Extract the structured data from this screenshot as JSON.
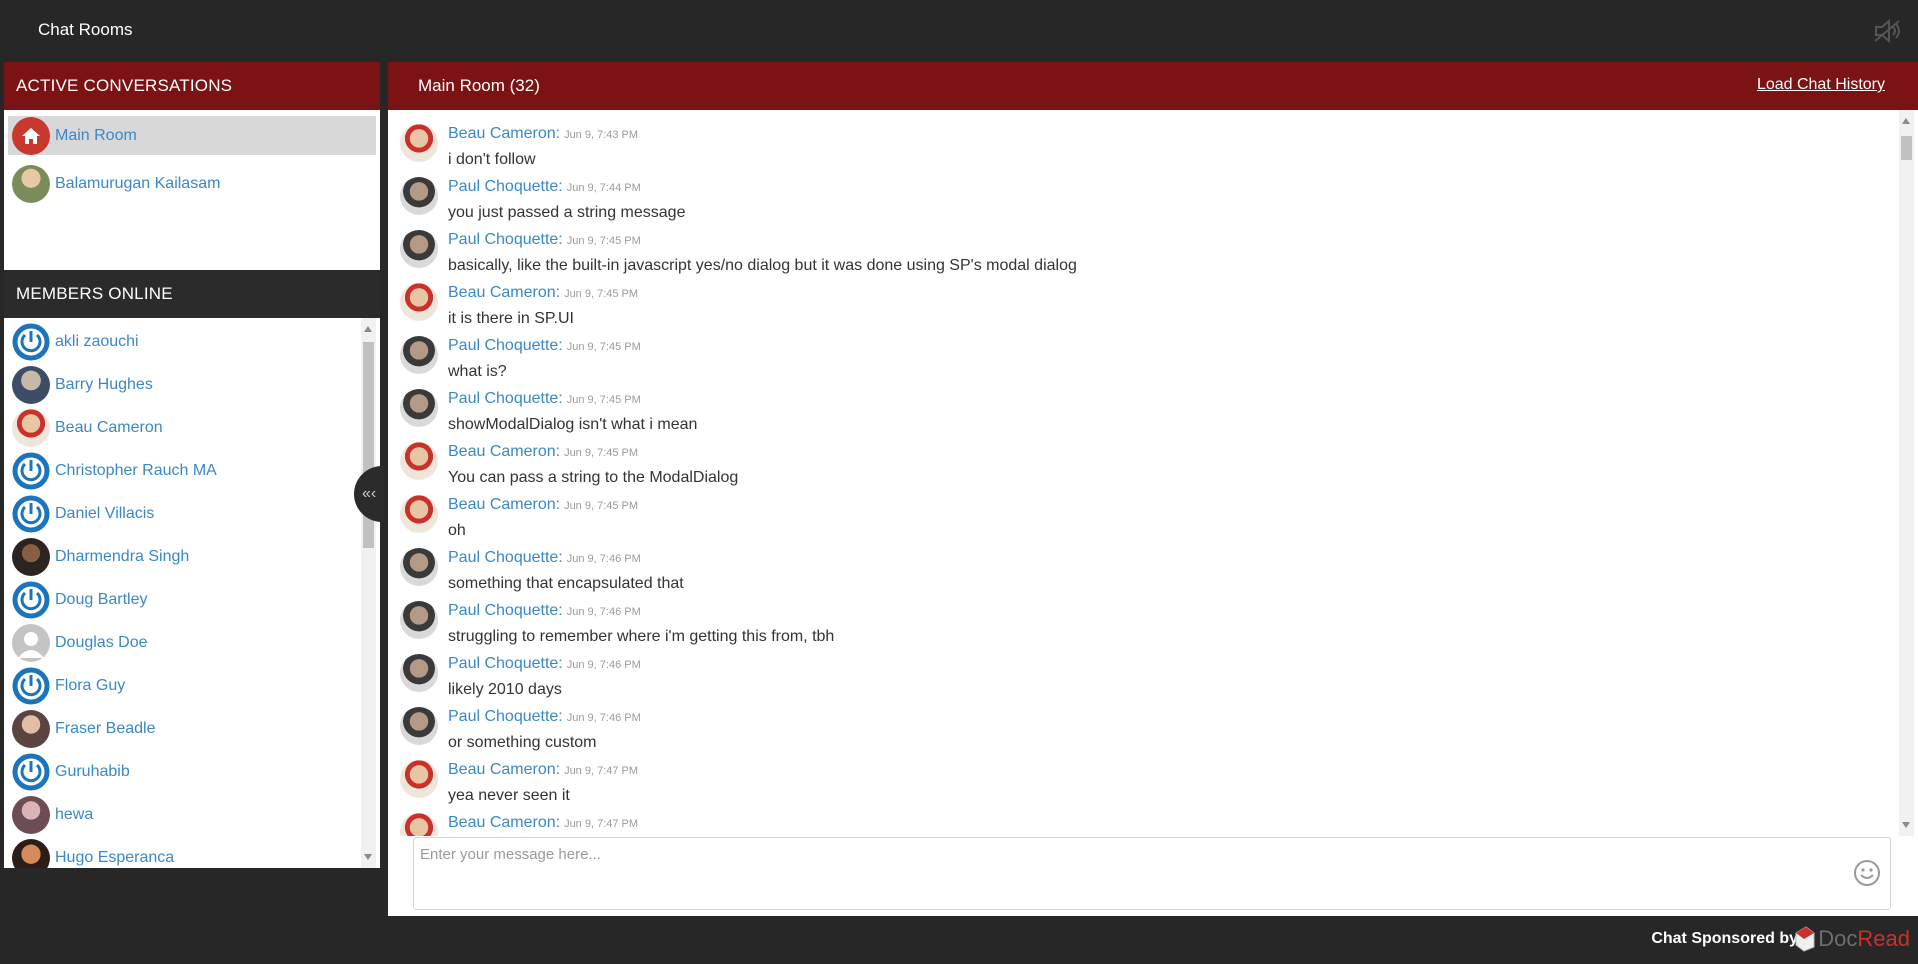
{
  "app": {
    "title": "Chat Rooms"
  },
  "active_conversations": {
    "header": "ACTIVE CONVERSATIONS",
    "items": [
      {
        "label": "Main Room",
        "avatar": "home-icon",
        "selected": true
      },
      {
        "label": "Balamurugan Kailasam",
        "avatar": "photo"
      }
    ]
  },
  "members_online": {
    "header": "MEMBERS ONLINE",
    "items": [
      {
        "label": "akli zaouchi",
        "avatar": "power-icon"
      },
      {
        "label": "Barry Hughes",
        "avatar": "photo"
      },
      {
        "label": "Beau Cameron",
        "avatar": "photo"
      },
      {
        "label": "Christopher Rauch MA",
        "avatar": "power-icon"
      },
      {
        "label": "Daniel Villacis",
        "avatar": "power-icon"
      },
      {
        "label": "Dharmendra Singh",
        "avatar": "photo"
      },
      {
        "label": "Doug Bartley",
        "avatar": "power-icon"
      },
      {
        "label": "Douglas Doe",
        "avatar": "default-user-icon"
      },
      {
        "label": "Flora Guy",
        "avatar": "power-icon"
      },
      {
        "label": "Fraser Beadle",
        "avatar": "photo"
      },
      {
        "label": "Guruhabib",
        "avatar": "power-icon"
      },
      {
        "label": "hewa",
        "avatar": "photo"
      },
      {
        "label": "Hugo Esperanca",
        "avatar": "photo"
      }
    ],
    "collapse_label": "«‹"
  },
  "main": {
    "room_title": "Main Room (32)",
    "history_link": "Load Chat History",
    "messages": [
      {
        "user": "Beau Cameron:",
        "time": "Jun 9, 7:43 PM",
        "text": "i don't follow"
      },
      {
        "user": "Paul Choquette:",
        "time": "Jun 9, 7:44 PM",
        "text": "you just passed a string message"
      },
      {
        "user": "Paul Choquette:",
        "time": "Jun 9, 7:45 PM",
        "text": "basically, like the built-in javascript yes/no dialog but it was done using SP's modal dialog"
      },
      {
        "user": "Beau Cameron:",
        "time": "Jun 9, 7:45 PM",
        "text": "it is there in SP.UI"
      },
      {
        "user": "Paul Choquette:",
        "time": "Jun 9, 7:45 PM",
        "text": "what is?"
      },
      {
        "user": "Paul Choquette:",
        "time": "Jun 9, 7:45 PM",
        "text": "showModalDialog isn't what i mean"
      },
      {
        "user": "Beau Cameron:",
        "time": "Jun 9, 7:45 PM",
        "text": "You can pass a string to the ModalDialog"
      },
      {
        "user": "Beau Cameron:",
        "time": "Jun 9, 7:45 PM",
        "text": "oh"
      },
      {
        "user": "Paul Choquette:",
        "time": "Jun 9, 7:46 PM",
        "text": "something that encapsulated that"
      },
      {
        "user": "Paul Choquette:",
        "time": "Jun 9, 7:46 PM",
        "text": "struggling to remember where i'm getting this from, tbh"
      },
      {
        "user": "Paul Choquette:",
        "time": "Jun 9, 7:46 PM",
        "text": "likely 2010 days"
      },
      {
        "user": "Paul Choquette:",
        "time": "Jun 9, 7:46 PM",
        "text": "or something custom"
      },
      {
        "user": "Beau Cameron:",
        "time": "Jun 9, 7:47 PM",
        "text": "yea never seen it"
      },
      {
        "user": "Beau Cameron:",
        "time": "Jun 9, 7:47 PM",
        "text": ""
      }
    ],
    "composer_placeholder": "Enter your message here..."
  },
  "footer": {
    "sponsor_text": "Chat Sponsored by",
    "logo_doc": "Doc",
    "logo_read": "Read"
  },
  "colors": {
    "header_red": "#7b1213",
    "dark_bg": "#272727",
    "link_blue": "#3a88c8"
  }
}
